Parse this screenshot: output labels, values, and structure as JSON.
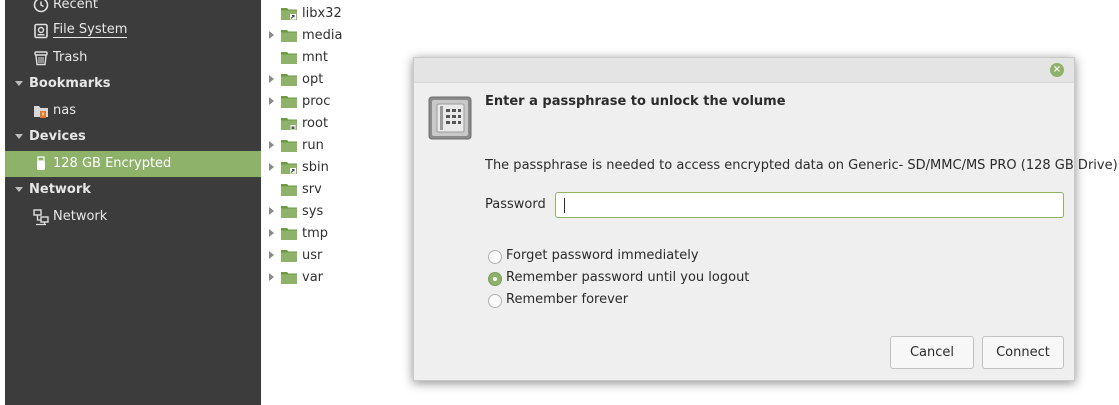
{
  "sidebar": {
    "places": [
      {
        "label": "Recent",
        "icon": "clock-icon"
      },
      {
        "label": "File System",
        "icon": "drive-icon"
      },
      {
        "label": "Trash",
        "icon": "trash-icon"
      }
    ],
    "sections": {
      "bookmarks": "Bookmarks",
      "devices": "Devices",
      "network": "Network"
    },
    "bookmark_items": [
      {
        "label": "nas",
        "icon": "network-folder-icon"
      }
    ],
    "device_items": [
      {
        "label": "128 GB Encrypted",
        "icon": "usb-drive-icon"
      }
    ],
    "network_items": [
      {
        "label": "Network",
        "icon": "network-icon"
      }
    ],
    "selected_color": "#8fb26a"
  },
  "tree": {
    "items": [
      {
        "name": "libx32",
        "expandable": false,
        "link": true
      },
      {
        "name": "media",
        "expandable": true,
        "link": false
      },
      {
        "name": "mnt",
        "expandable": false,
        "link": false
      },
      {
        "name": "opt",
        "expandable": true,
        "link": false
      },
      {
        "name": "proc",
        "expandable": true,
        "link": false
      },
      {
        "name": "root",
        "expandable": false,
        "link": false,
        "locked": true
      },
      {
        "name": "run",
        "expandable": true,
        "link": false
      },
      {
        "name": "sbin",
        "expandable": true,
        "link": true
      },
      {
        "name": "srv",
        "expandable": false,
        "link": false
      },
      {
        "name": "sys",
        "expandable": true,
        "link": false
      },
      {
        "name": "tmp",
        "expandable": true,
        "link": false
      },
      {
        "name": "usr",
        "expandable": true,
        "link": false
      },
      {
        "name": "var",
        "expandable": true,
        "link": false
      }
    ]
  },
  "dialog": {
    "title": "Enter a passphrase to unlock the volume",
    "description": "The passphrase is needed to access encrypted data on Generic- SD/MMC/MS PRO (128 GB Drive).",
    "password_label": "Password",
    "password_value": "",
    "options": [
      {
        "label": "Forget password immediately",
        "checked": false
      },
      {
        "label": "Remember password until you logout",
        "checked": true
      },
      {
        "label": "Remember forever",
        "checked": false
      }
    ],
    "cancel_label": "Cancel",
    "connect_label": "Connect",
    "accent_color": "#8fb26a"
  }
}
